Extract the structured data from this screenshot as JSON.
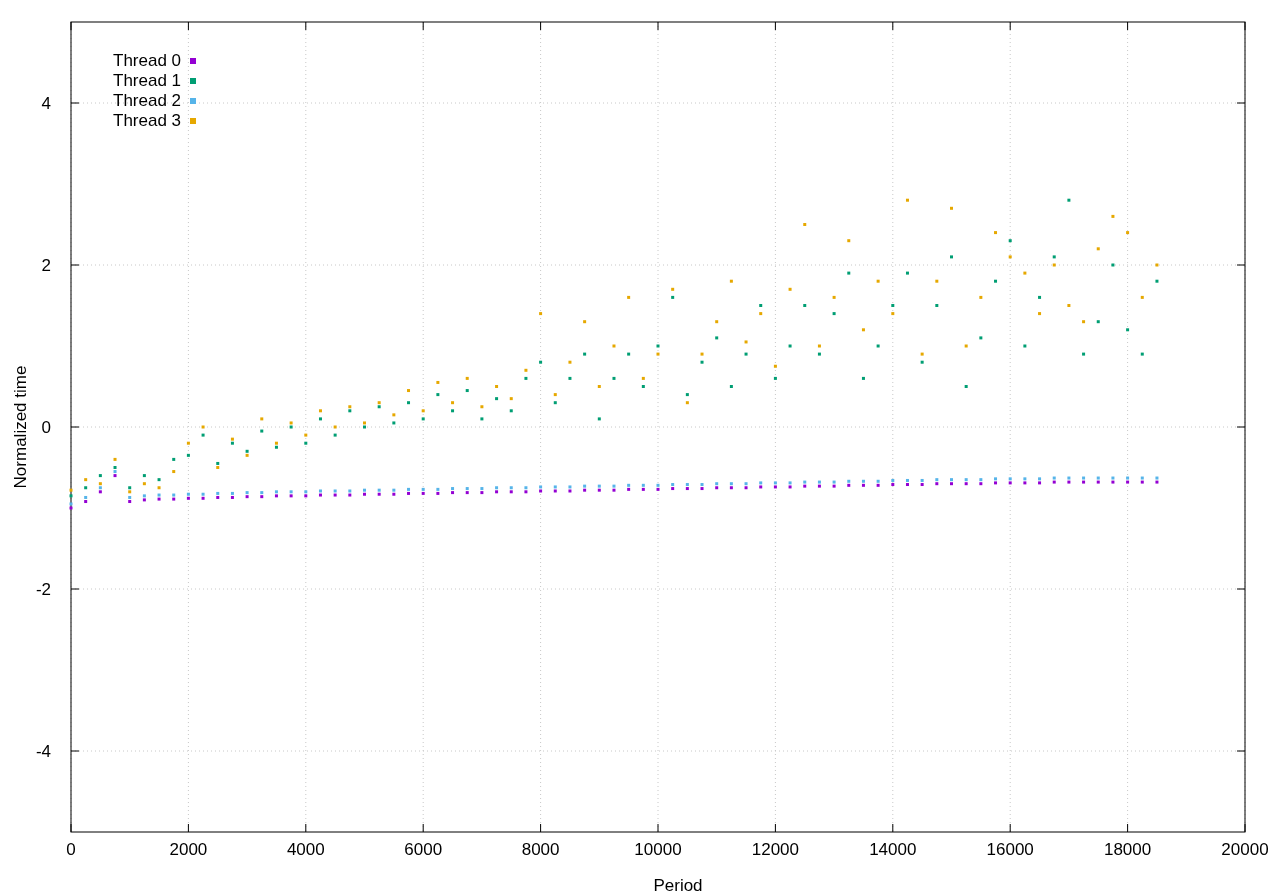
{
  "chart_data": {
    "type": "scatter",
    "xlabel": "Period",
    "ylabel": "Normalized time",
    "grid": true,
    "legend": true,
    "x": [
      0,
      250,
      500,
      750,
      1000,
      1250,
      1500,
      1750,
      2000,
      2250,
      2500,
      2750,
      3000,
      3250,
      3500,
      3750,
      4000,
      4250,
      4500,
      4750,
      5000,
      5250,
      5500,
      5750,
      6000,
      6250,
      6500,
      6750,
      7000,
      7250,
      7500,
      7750,
      8000,
      8250,
      8500,
      8750,
      9000,
      9250,
      9500,
      9750,
      10000,
      10250,
      10500,
      10750,
      11000,
      11250,
      11500,
      11750,
      12000,
      12250,
      12500,
      12750,
      13000,
      13250,
      13500,
      13750,
      14000,
      14250,
      14500,
      14750,
      15000,
      15250,
      15500,
      15750,
      16000,
      16250,
      16500,
      16750,
      17000,
      17250,
      17500,
      17750,
      18000,
      18250,
      18500
    ],
    "series": [
      {
        "name": "Thread 0",
        "color": "#9400d3",
        "values": [
          -1.0,
          -0.92,
          -0.8,
          -0.6,
          -0.92,
          -0.9,
          -0.89,
          -0.89,
          -0.88,
          -0.88,
          -0.87,
          -0.87,
          -0.86,
          -0.86,
          -0.85,
          -0.85,
          -0.85,
          -0.84,
          -0.84,
          -0.84,
          -0.83,
          -0.83,
          -0.83,
          -0.82,
          -0.82,
          -0.82,
          -0.81,
          -0.81,
          -0.81,
          -0.8,
          -0.8,
          -0.8,
          -0.79,
          -0.79,
          -0.79,
          -0.78,
          -0.78,
          -0.78,
          -0.77,
          -0.77,
          -0.77,
          -0.76,
          -0.76,
          -0.76,
          -0.75,
          -0.75,
          -0.75,
          -0.74,
          -0.74,
          -0.74,
          -0.73,
          -0.73,
          -0.73,
          -0.72,
          -0.72,
          -0.72,
          -0.71,
          -0.71,
          -0.71,
          -0.7,
          -0.7,
          -0.7,
          -0.7,
          -0.69,
          -0.69,
          -0.69,
          -0.69,
          -0.68,
          -0.68,
          -0.68,
          -0.68,
          -0.68,
          -0.68,
          -0.68,
          -0.68
        ]
      },
      {
        "name": "Thread 1",
        "color": "#009e73",
        "values": [
          -0.85,
          -0.75,
          -0.6,
          -0.5,
          -0.75,
          -0.6,
          -0.65,
          -0.4,
          -0.35,
          -0.1,
          -0.45,
          -0.2,
          -0.3,
          -0.05,
          -0.25,
          0.0,
          -0.2,
          0.1,
          -0.1,
          0.2,
          0.0,
          0.25,
          0.05,
          0.3,
          0.1,
          0.4,
          0.2,
          0.45,
          0.1,
          0.35,
          0.2,
          0.6,
          0.8,
          0.3,
          0.6,
          0.9,
          0.1,
          0.6,
          0.9,
          0.5,
          1.0,
          1.6,
          0.4,
          0.8,
          1.1,
          0.5,
          0.9,
          1.5,
          0.6,
          1.0,
          1.5,
          0.9,
          1.4,
          1.9,
          0.6,
          1.0,
          1.5,
          1.9,
          0.8,
          1.5,
          2.1,
          0.5,
          1.1,
          1.8,
          2.3,
          1.0,
          1.6,
          2.1,
          2.8,
          0.9,
          1.3,
          2.0,
          1.2,
          0.9,
          1.8
        ]
      },
      {
        "name": "Thread 2",
        "color": "#56b4e9",
        "values": [
          -0.95,
          -0.87,
          -0.75,
          -0.55,
          -0.87,
          -0.85,
          -0.84,
          -0.84,
          -0.83,
          -0.83,
          -0.82,
          -0.82,
          -0.81,
          -0.81,
          -0.8,
          -0.8,
          -0.8,
          -0.79,
          -0.79,
          -0.79,
          -0.78,
          -0.78,
          -0.78,
          -0.77,
          -0.77,
          -0.77,
          -0.76,
          -0.76,
          -0.76,
          -0.75,
          -0.75,
          -0.75,
          -0.74,
          -0.74,
          -0.74,
          -0.73,
          -0.73,
          -0.73,
          -0.72,
          -0.72,
          -0.72,
          -0.71,
          -0.71,
          -0.71,
          -0.7,
          -0.7,
          -0.7,
          -0.69,
          -0.69,
          -0.69,
          -0.68,
          -0.68,
          -0.68,
          -0.67,
          -0.67,
          -0.67,
          -0.66,
          -0.66,
          -0.66,
          -0.65,
          -0.65,
          -0.65,
          -0.65,
          -0.64,
          -0.64,
          -0.64,
          -0.64,
          -0.63,
          -0.63,
          -0.63,
          -0.63,
          -0.63,
          -0.63,
          -0.63,
          -0.63
        ]
      },
      {
        "name": "Thread 3",
        "color": "#e6a800",
        "values": [
          -0.78,
          -0.65,
          -0.7,
          -0.4,
          -0.8,
          -0.7,
          -0.75,
          -0.55,
          -0.2,
          0.0,
          -0.5,
          -0.15,
          -0.35,
          0.1,
          -0.2,
          0.05,
          -0.1,
          0.2,
          0.0,
          0.25,
          0.05,
          0.3,
          0.15,
          0.45,
          0.2,
          0.55,
          0.3,
          0.6,
          0.25,
          0.5,
          0.35,
          0.7,
          1.4,
          0.4,
          0.8,
          1.3,
          0.5,
          1.0,
          1.6,
          0.6,
          0.9,
          1.7,
          0.3,
          0.9,
          1.3,
          1.8,
          1.05,
          1.4,
          0.75,
          1.7,
          2.5,
          1.0,
          1.6,
          2.3,
          1.2,
          1.8,
          1.4,
          2.8,
          0.9,
          1.8,
          2.7,
          1.0,
          1.6,
          2.4,
          2.1,
          1.9,
          1.4,
          2.0,
          1.5,
          1.3,
          2.2,
          2.6,
          2.4,
          1.6,
          2.0
        ]
      }
    ],
    "xlim": [
      0,
      20000
    ],
    "ylim": [
      -5,
      5
    ],
    "xticks": [
      0,
      2000,
      4000,
      6000,
      8000,
      10000,
      12000,
      14000,
      16000,
      18000,
      20000
    ],
    "yticks": [
      -4,
      -2,
      0,
      2,
      4
    ]
  }
}
